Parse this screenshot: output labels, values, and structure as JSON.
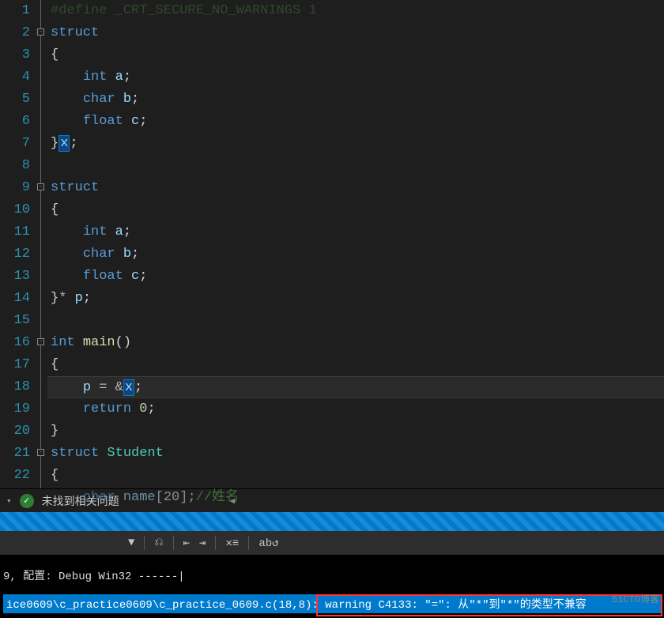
{
  "gutter": [
    "1",
    "2",
    "3",
    "4",
    "5",
    "6",
    "7",
    "8",
    "9",
    "10",
    "11",
    "12",
    "13",
    "14",
    "15",
    "16",
    "17",
    "18",
    "19",
    "20",
    "21",
    "22"
  ],
  "code": {
    "l1_comment": "#define _CRT_SECURE_NO_WARNINGS 1",
    "struct_kw": "struct",
    "brace_open": "{",
    "brace_close": "}",
    "int_kw": "int",
    "char_kw": "char",
    "float_kw": "float",
    "a": "a",
    "b": "b",
    "c": "c",
    "x": "x",
    "p": "p",
    "main": "main",
    "eq": "=",
    "amp": "&",
    "return_kw": "return",
    "zero": "0",
    "student": "Student",
    "name": "name",
    "arr": "[20]",
    "star": "*",
    "cmt": "//姓名",
    "char_front": "cha",
    "char_last": "r"
  },
  "errorbar": {
    "no_issues": "未找到相关问题",
    "arrow": "◀"
  },
  "toolbar": {
    "dd": "▼",
    "i1": "⎌",
    "i2": "⇤",
    "i3": "⇥",
    "i4": "✕≡",
    "i5": "ab↺"
  },
  "output": {
    "line1": "9, 配置: Debug Win32 ------|",
    "path": "ice0609\\c_practice0609\\c_practice_0609.c(18,8)",
    "warn": ": warning C4133: \"=\": 从\"*\"到\"*\"的类型不兼容"
  },
  "watermark": "51CTO博客"
}
